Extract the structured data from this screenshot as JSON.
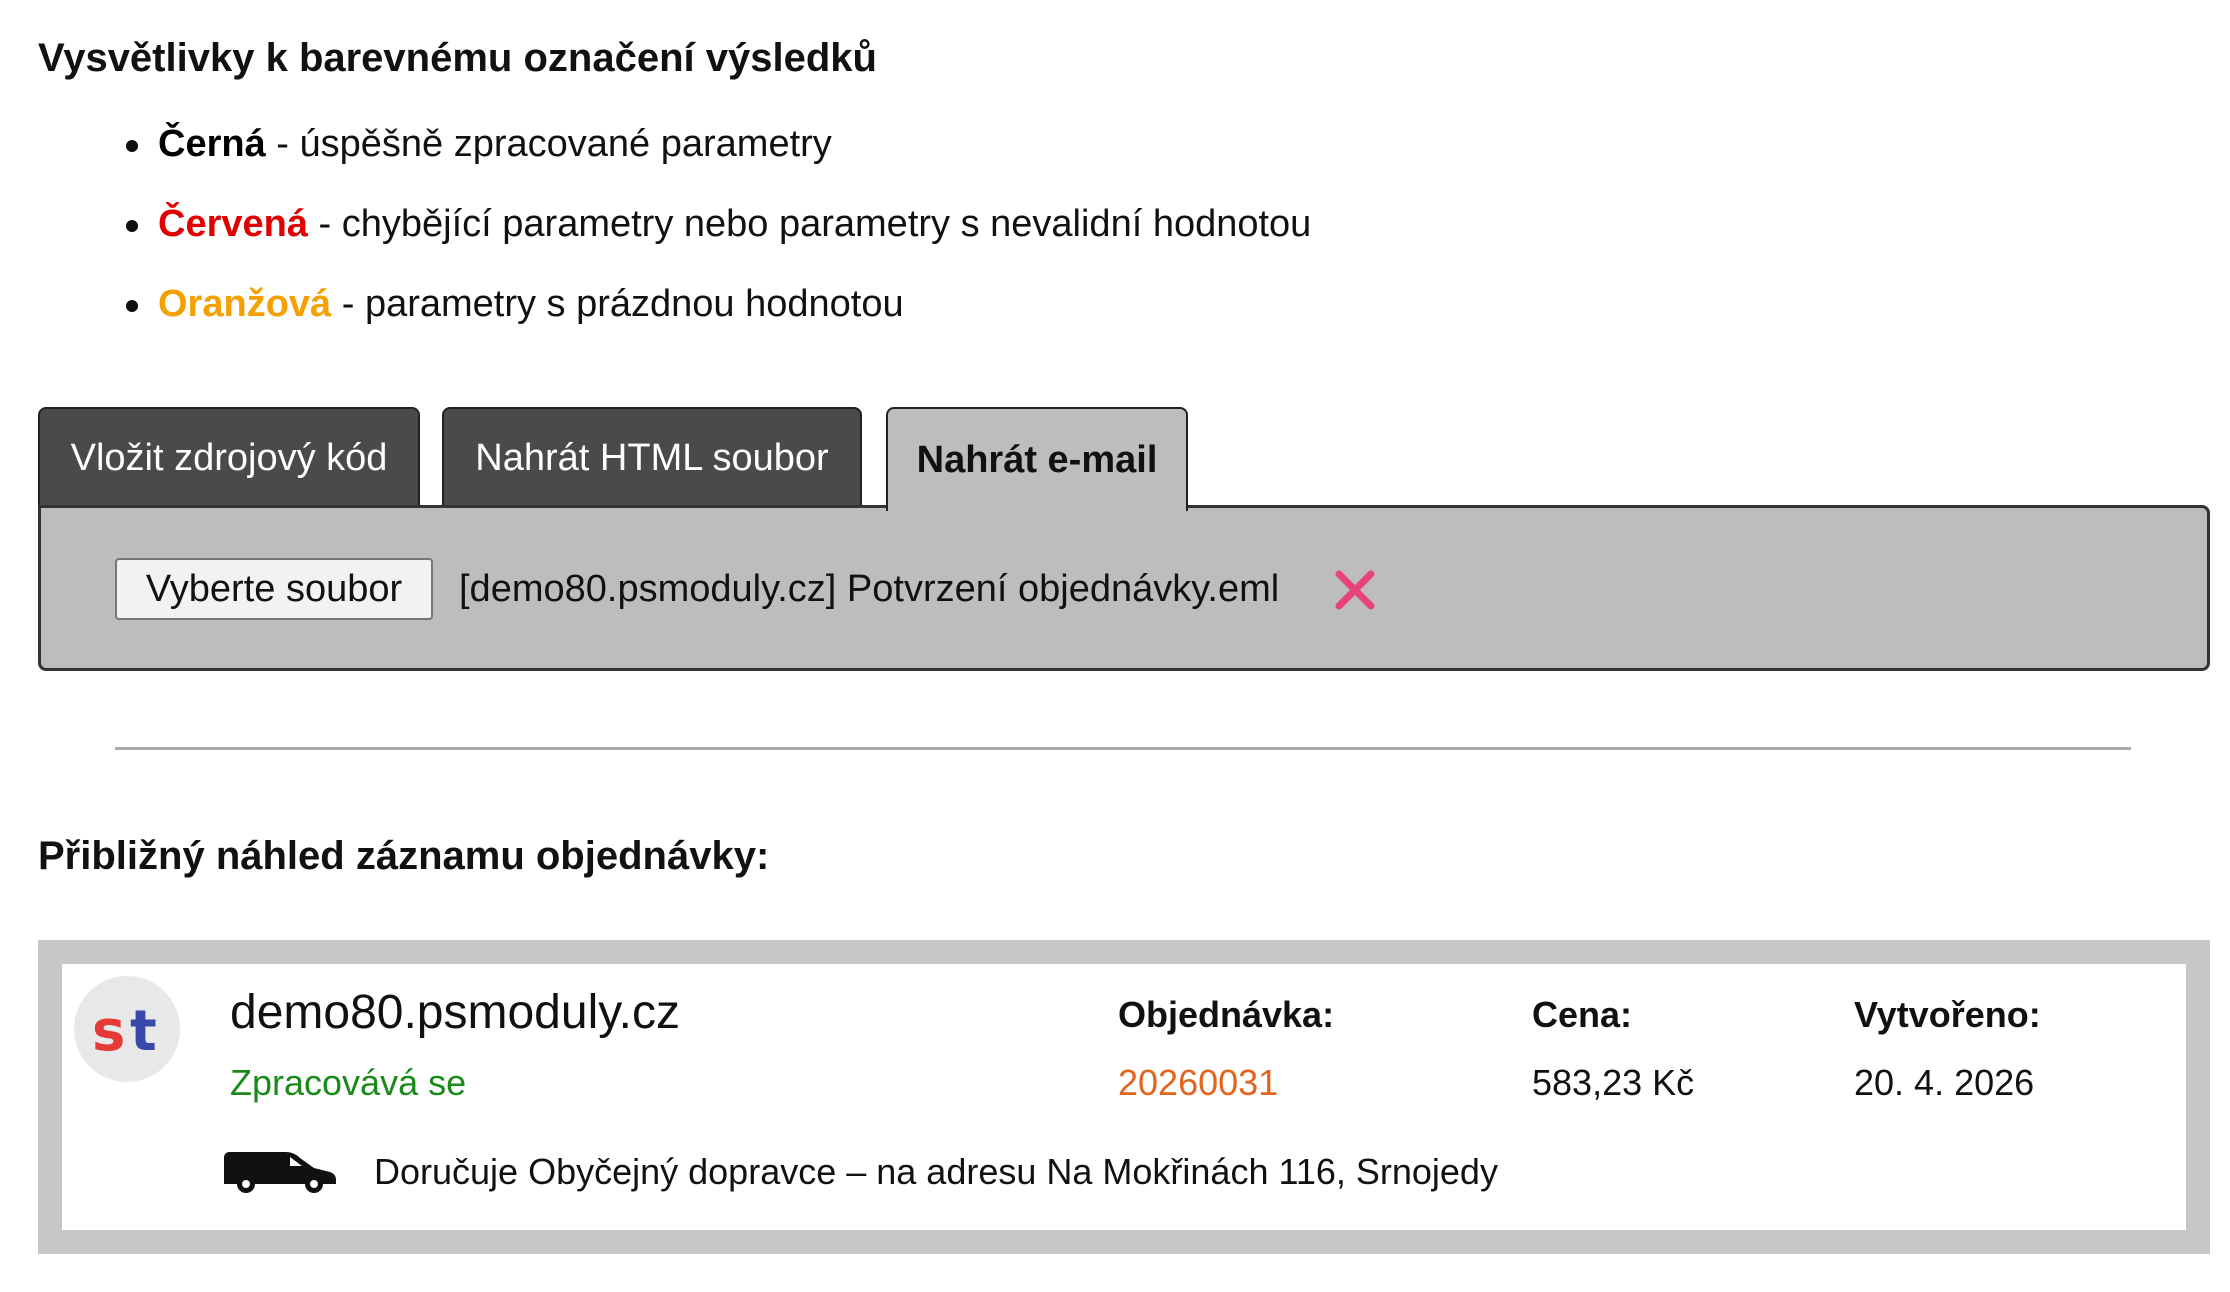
{
  "legend": {
    "title": "Vysvětlivky k barevnému označení výsledků",
    "items": [
      {
        "term": "Černá",
        "description": " - úspěšně zpracované parametry",
        "color": "#000000"
      },
      {
        "term": "Červená",
        "description": " - chybějící parametry nebo parametry s nevalidní hodnotou",
        "color": "#e00000"
      },
      {
        "term": "Oranžová",
        "description": " - parametry s prázdnou hodnotou",
        "color": "#f5a000"
      }
    ]
  },
  "tabs": [
    {
      "label": "Vložit zdrojový kód",
      "active": false
    },
    {
      "label": "Nahrát HTML soubor",
      "active": false
    },
    {
      "label": "Nahrát e-mail",
      "active": true
    }
  ],
  "upload": {
    "button_label": "Vyberte soubor",
    "file_name": "[demo80.psmoduly.cz] Potvrzení objednávky.eml",
    "remove_icon": "close-icon",
    "remove_color": "#e8447a"
  },
  "preview": {
    "title": "Přibližný náhled záznamu objednávky:",
    "shop_name": "demo80.psmoduly.cz",
    "status": "Zpracovává se",
    "status_color": "#1a8a1a",
    "order_label": "Objednávka:",
    "order_number": "20260031",
    "order_number_color": "#e2651f",
    "price_label": "Cena:",
    "price": "583,23 Kč",
    "created_label": "Vytvořeno:",
    "created": "20. 4. 2026",
    "delivery_icon": "van-icon",
    "delivery_text": "Doručuje Obyčejný dopravce – na adresu Na Mokřinách 116, Srnojedy"
  }
}
